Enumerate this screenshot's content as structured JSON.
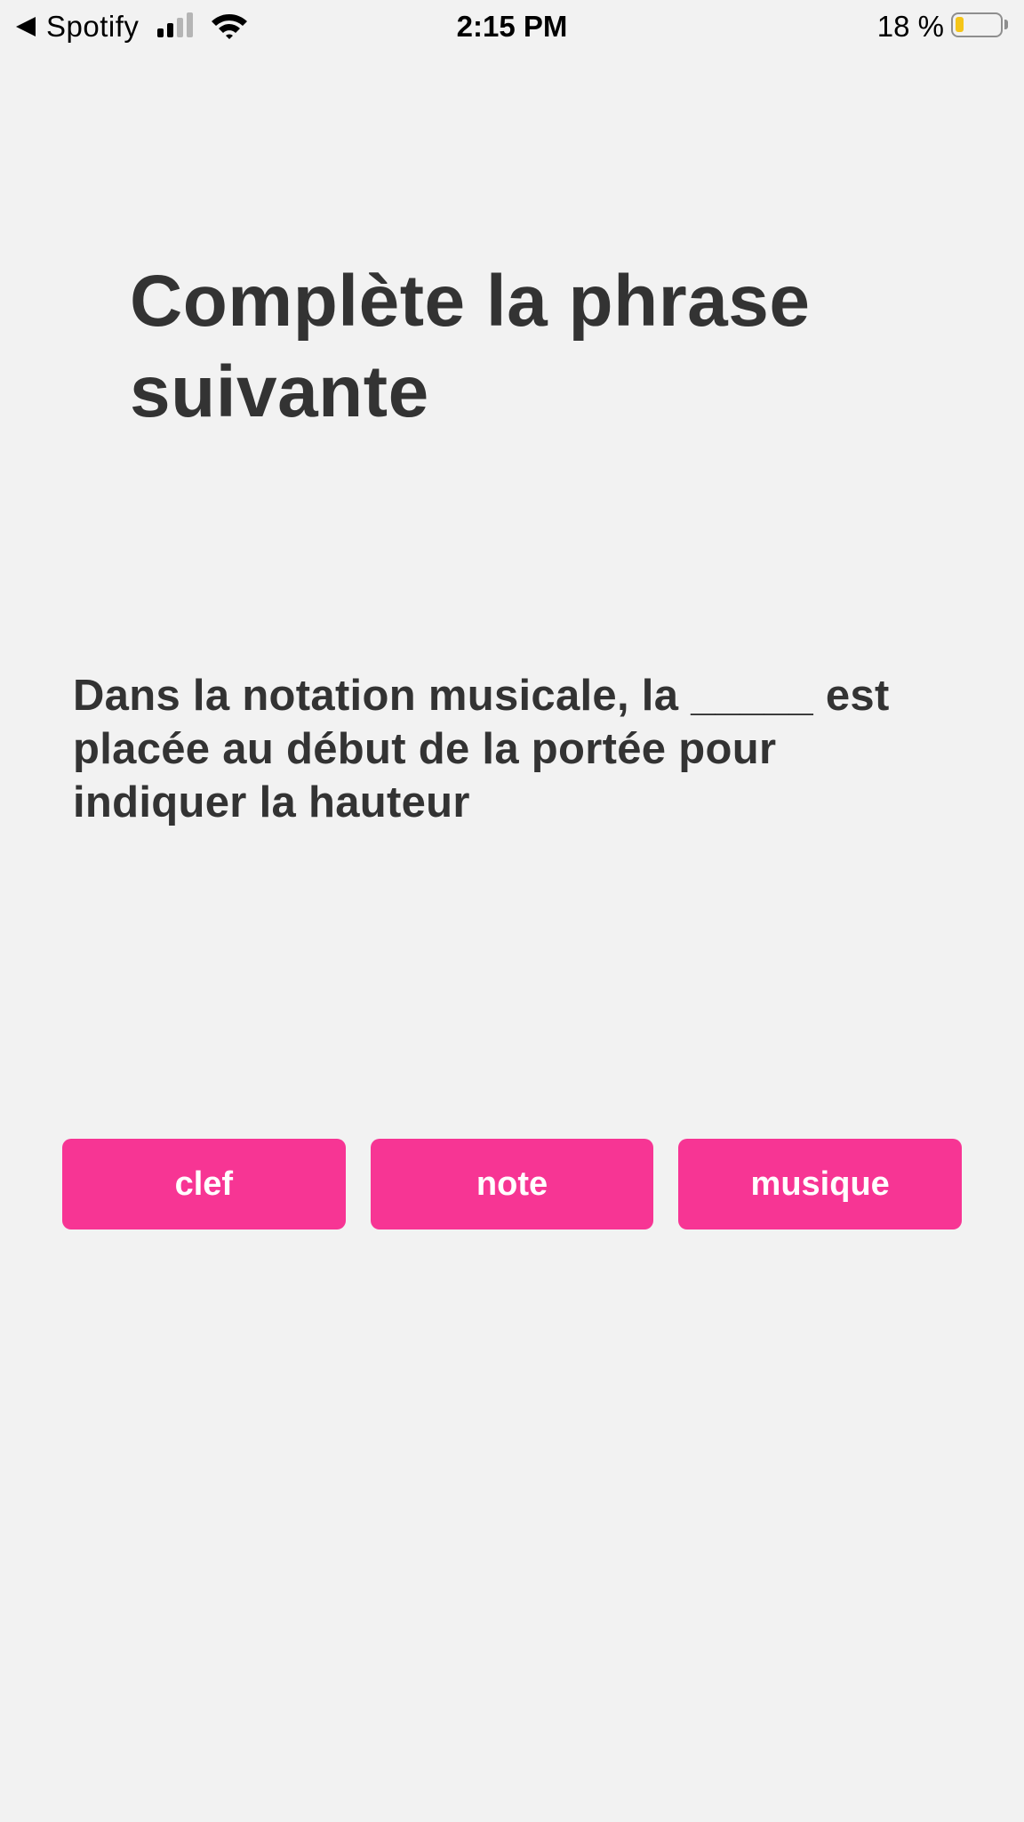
{
  "status_bar": {
    "back_app": "Spotify",
    "time": "2:15 PM",
    "battery_percent": "18 %",
    "battery_level": 0.18,
    "signal_bars_filled": 2,
    "signal_bars_total": 4
  },
  "quiz": {
    "title": "Complète la phrase suivante",
    "question": "Dans la notation musicale, la _____ est placée au début de la portée pour indiquer la hauteur",
    "answers": [
      {
        "label": "clef"
      },
      {
        "label": "note"
      },
      {
        "label": "musique"
      }
    ]
  },
  "colors": {
    "background": "#f2f2f2",
    "text": "#333333",
    "accent": "#f73594",
    "battery_fill": "#f5c518",
    "signal_active": "#000000",
    "signal_inactive": "#b5b5b5"
  },
  "icons": {
    "back": "back-arrow-icon",
    "signal": "cellular-signal-icon",
    "wifi": "wifi-icon",
    "battery": "battery-icon"
  }
}
